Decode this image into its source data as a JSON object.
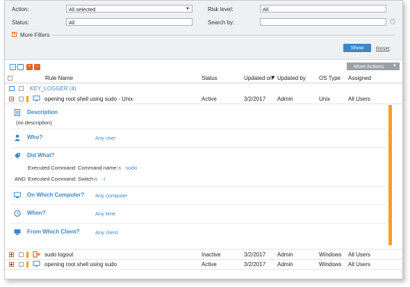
{
  "filters": {
    "action_label": "Action:",
    "action_value": "All selected",
    "risk_label": "Risk level:",
    "risk_value": "All",
    "status_label": "Status:",
    "status_value": "All",
    "search_label": "Search by:",
    "search_value": "",
    "more_filters": "More Filters",
    "show_button": "Show",
    "reset_link": "Reset"
  },
  "toolbar": {
    "more_actions": "More Actions"
  },
  "table": {
    "headers": {
      "rule_name": "Rule Name",
      "status": "Status",
      "updated_on": "Updated on",
      "updated_by": "Updated by",
      "os_type": "OS Type",
      "assigned": "Assigned"
    },
    "group_title": "KEY_LOGGER (4)",
    "expanded_row": {
      "name": "opening root shell using sudo - Unix",
      "status": "Active",
      "updated_on": "3/2/2017",
      "updated_by": "Admin",
      "os_type": "Unix",
      "assigned": "All Users"
    },
    "rows": [
      {
        "name": "sudo logout",
        "status": "Inactive",
        "updated_on": "3/2/2017",
        "updated_by": "Admin",
        "os_type": "Windows",
        "assigned": "All Users",
        "bar_color": "#f2a21d"
      },
      {
        "name": "opening root shell using sudo",
        "status": "Active",
        "updated_on": "3/2/2017",
        "updated_by": "Admin",
        "os_type": "Windows",
        "assigned": "All Users",
        "bar_color": "#f2a21d"
      }
    ]
  },
  "detail": {
    "description_title": "Description",
    "description_text": "(no description)",
    "who_title": "Who?",
    "who_value": "Any user",
    "did_what_title": "Did What?",
    "cmd1_label": "Executed Command: Command name",
    "cmd1_op": "is",
    "cmd1_value": "sudo",
    "and_label": "AND",
    "cmd2_label": "Executed Command: Switch",
    "cmd2_op": "is",
    "cmd2_value": "-i",
    "computer_title": "On Which Computer?",
    "computer_value": "Any computer",
    "when_title": "When?",
    "when_value": "Any time",
    "client_title": "From Which Client?",
    "client_value": "Any client"
  },
  "colors": {
    "accent": "#3d87c8",
    "orange": "#f2a21d",
    "red": "#e0652a"
  }
}
